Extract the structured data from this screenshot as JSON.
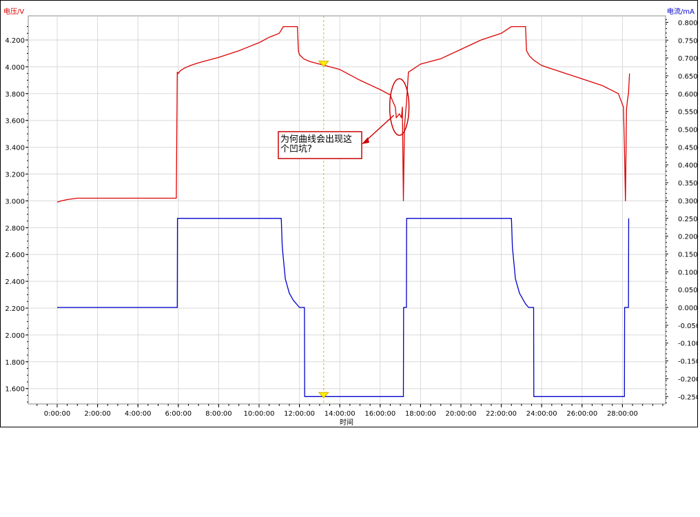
{
  "chart_data": {
    "type": "line",
    "title": "",
    "xlabel": "时间",
    "xlim_hours": [
      0,
      28.5
    ],
    "x_ticks": [
      "0:00:00",
      "2:00:00",
      "4:00:00",
      "6:00:00",
      "8:00:00",
      "10:00:00",
      "12:00:00",
      "14:00:00",
      "16:00:00",
      "18:00:00",
      "20:00:00",
      "22:00:00",
      "24:00:00",
      "26:00:00",
      "28:00:00"
    ],
    "y_left": {
      "label": "电压/V",
      "lim": [
        1.5,
        4.3
      ],
      "ticks": [
        "1.600",
        "1.800",
        "2.000",
        "2.200",
        "2.400",
        "2.600",
        "2.800",
        "3.000",
        "3.200",
        "3.400",
        "3.600",
        "3.800",
        "4.000",
        "4.200"
      ],
      "color": "#dd0000"
    },
    "y_right": {
      "label": "电流/mA",
      "lim": [
        -0.28,
        0.82
      ],
      "ticks": [
        "0.800",
        "0.750",
        "0.700",
        "0.650",
        "0.600",
        "0.550",
        "0.500",
        "0.450",
        "0.400",
        "0.350",
        "0.300",
        "0.250",
        "0.200",
        "0.150",
        "0.100",
        "0.050",
        "0.000",
        "-0.050",
        "-0.100",
        "-0.150",
        "-0.200",
        "-0.250"
      ],
      "color": "#0000cc"
    },
    "grid": true,
    "cursor_x_hours": 13.2,
    "series": [
      {
        "axis": "left",
        "color": "#dd0000",
        "x": [
          0,
          0.2,
          0.5,
          1,
          2,
          3,
          4,
          5,
          5.9,
          5.95,
          6.0,
          6.1,
          6.3,
          6.6,
          7,
          8,
          9,
          9.5,
          10,
          10.5,
          11,
          11.2,
          11.25,
          11.9,
          11.95,
          12.0,
          12.2,
          12.5,
          13.0,
          13.5,
          14,
          15,
          16,
          16.5,
          16.6,
          16.75,
          16.8,
          16.85,
          16.95,
          17.05,
          17.1,
          17.15,
          17.2,
          17.3,
          17.4,
          17.6,
          18,
          19,
          20,
          21,
          22,
          22.5,
          22.55,
          23.2,
          23.25,
          23.4,
          23.6,
          24,
          25,
          26,
          27,
          27.8,
          28.05,
          28.1,
          28.15,
          28.2,
          28.25,
          28.3,
          28.35
        ],
        "y": [
          2.99,
          3.0,
          3.01,
          3.02,
          3.02,
          3.02,
          3.02,
          3.02,
          3.02,
          3.96,
          3.95,
          3.97,
          3.99,
          4.01,
          4.03,
          4.07,
          4.12,
          4.15,
          4.18,
          4.22,
          4.25,
          4.3,
          4.3,
          4.3,
          4.12,
          4.09,
          4.06,
          4.04,
          4.02,
          4.0,
          3.98,
          3.9,
          3.83,
          3.79,
          3.75,
          3.7,
          3.62,
          3.63,
          3.65,
          3.62,
          3.7,
          3.0,
          3.55,
          3.73,
          3.96,
          3.98,
          4.02,
          4.06,
          4.13,
          4.2,
          4.25,
          4.3,
          4.3,
          4.3,
          4.12,
          4.08,
          4.05,
          4.01,
          3.96,
          3.91,
          3.86,
          3.8,
          3.7,
          3.4,
          3.0,
          3.68,
          3.75,
          3.8,
          3.95
        ]
      },
      {
        "axis": "right",
        "color": "#0000cc",
        "x": [
          0,
          5.95,
          5.96,
          11.1,
          11.15,
          11.3,
          11.5,
          11.7,
          11.85,
          12.0,
          12.01,
          12.25,
          12.26,
          17.15,
          17.16,
          17.3,
          17.31,
          22.5,
          22.55,
          22.7,
          22.9,
          23.1,
          23.2,
          23.35,
          23.36,
          23.6,
          23.61,
          28.1,
          28.11,
          28.3,
          28.31
        ],
        "y": [
          0.0,
          0.0,
          0.25,
          0.25,
          0.17,
          0.08,
          0.04,
          0.02,
          0.01,
          0.0,
          0.0,
          0.0,
          -0.25,
          -0.25,
          0.0,
          0.0,
          0.25,
          0.25,
          0.17,
          0.08,
          0.04,
          0.02,
          0.01,
          0.0,
          0.0,
          0.0,
          -0.25,
          -0.25,
          0.0,
          0.0,
          0.25
        ]
      }
    ],
    "annotation": {
      "lines": [
        "为何曲线会出现这",
        "个凹坑?"
      ],
      "ellipse_center_hours": 16.95,
      "ellipse_center_voltage": 3.7,
      "border_color": "#cc0000"
    }
  }
}
